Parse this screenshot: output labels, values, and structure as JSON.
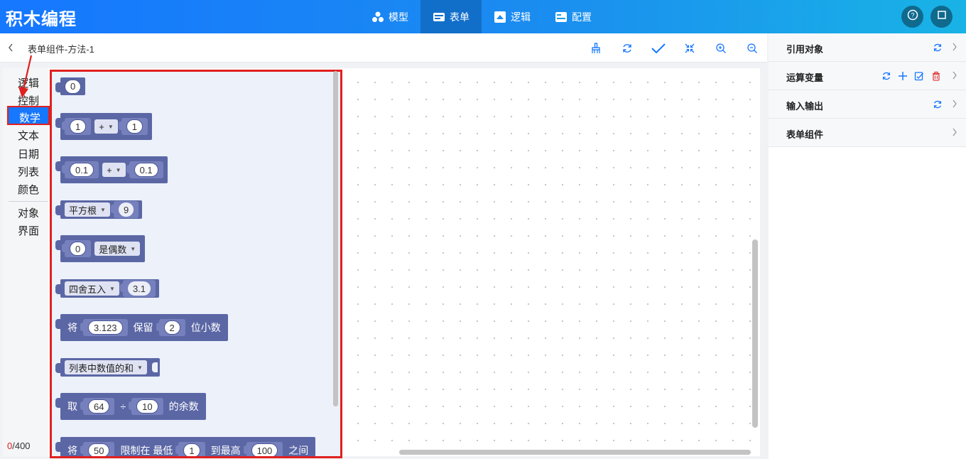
{
  "app": {
    "title": "积木编程"
  },
  "nav": {
    "tabs": [
      {
        "label": "模型",
        "icon": "cubes-icon"
      },
      {
        "label": "表单",
        "icon": "form-icon"
      },
      {
        "label": "逻辑",
        "icon": "puzzle-icon"
      },
      {
        "label": "配置",
        "icon": "settings-panel-icon"
      }
    ],
    "active_tab": "表单"
  },
  "breadcrumb": {
    "title": "表单组件-方法-1"
  },
  "categories": {
    "items": [
      "逻辑",
      "控制",
      "数学",
      "文本",
      "日期",
      "列表",
      "颜色",
      "对象",
      "界面"
    ],
    "selected": "数学"
  },
  "counter": {
    "used": "0",
    "limit": "/400"
  },
  "blocks": {
    "b1": {
      "value": "0"
    },
    "b2": {
      "a": "1",
      "op": "+",
      "b": "1"
    },
    "b3": {
      "a": "0.1",
      "op": "+",
      "b": "0.1"
    },
    "b4": {
      "fn": "平方根",
      "value": "9"
    },
    "b5": {
      "value": "0",
      "check": "是偶数"
    },
    "b6": {
      "fn": "四舍五入",
      "value": "3.1"
    },
    "b7": {
      "pre": "将",
      "value": "3.123",
      "mid": "保留",
      "digits": "2",
      "post": "位小数"
    },
    "b8": {
      "fn": "列表中数值的和"
    },
    "b9": {
      "pre": "取",
      "a": "64",
      "op": "÷",
      "b": "10",
      "post": "的余数"
    },
    "b10": {
      "pre": "将",
      "value": "50",
      "mid1": "限制在 最低",
      "low": "1",
      "mid2": "到最高",
      "high": "100",
      "post": "之间"
    }
  },
  "right_panel": {
    "rows": [
      {
        "label": "引用对象"
      },
      {
        "label": "运算变量"
      },
      {
        "label": "输入输出"
      },
      {
        "label": "表单组件"
      }
    ]
  },
  "colors": {
    "brand": "#1677ff",
    "block": "#5b67a5",
    "highlight": "#e02020",
    "delete": "#e04040"
  }
}
